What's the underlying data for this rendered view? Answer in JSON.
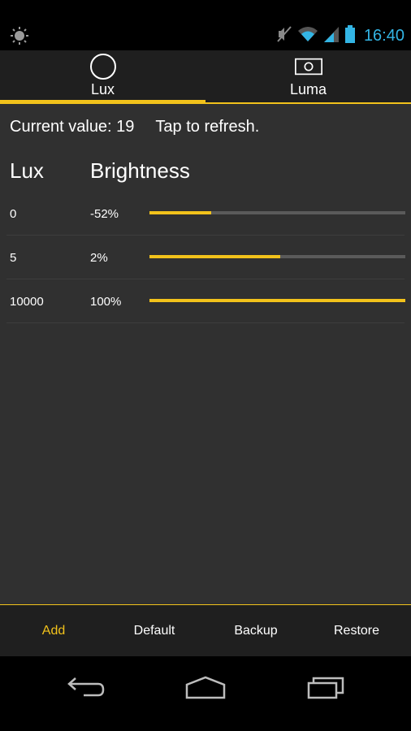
{
  "status_bar": {
    "time": "16:40",
    "icons": [
      "brightness-icon",
      "mute-icon",
      "wifi-icon",
      "signal-icon",
      "battery-icon"
    ]
  },
  "tabs": [
    {
      "label": "Lux",
      "icon": "circle-icon",
      "selected": true
    },
    {
      "label": "Luma",
      "icon": "camera-icon",
      "selected": false
    }
  ],
  "current": {
    "value_text": "Current value: 19",
    "refresh_text": "Tap to refresh."
  },
  "table": {
    "headers": {
      "lux": "Lux",
      "brightness": "Brightness"
    },
    "rows": [
      {
        "lux": "0",
        "brightness": "-52%",
        "level": 0.24
      },
      {
        "lux": "5",
        "brightness": "2%",
        "level": 0.51
      },
      {
        "lux": "10000",
        "brightness": "100%",
        "level": 1.0
      }
    ]
  },
  "bottom_bar": {
    "add": "Add",
    "default": "Default",
    "backup": "Backup",
    "restore": "Restore"
  },
  "navigation": [
    "back-icon",
    "home-icon",
    "recent-apps-icon"
  ],
  "colors": {
    "accent": "#f2c21b",
    "clock": "#33b5e5",
    "background": "#303030"
  }
}
